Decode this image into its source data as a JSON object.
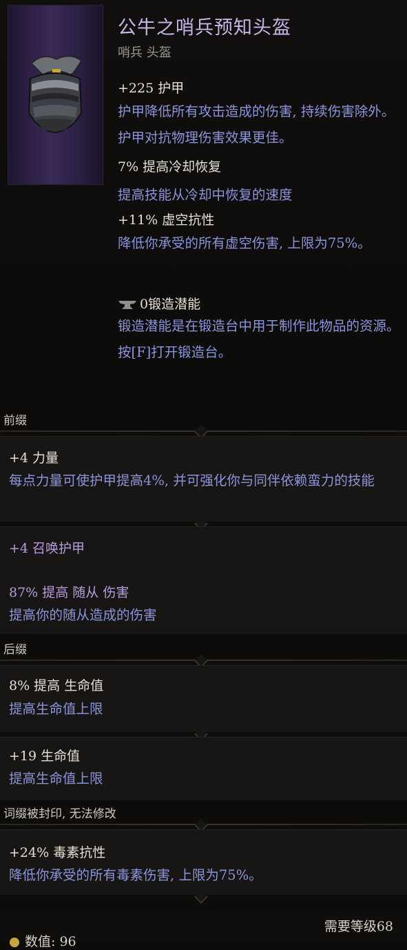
{
  "item": {
    "name": "公牛之哨兵预知头盔",
    "type": "哨兵 头盔",
    "armor_stat": "+225 护甲",
    "armor_desc": "护甲降低所有攻击造成的伤害, 持续伤害除外。护甲对抗物理伤害效果更佳。",
    "cooldown_stat": "7% 提高冷却恢复",
    "cooldown_desc": "提高技能从冷却中恢复的速度",
    "void_stat": "+11% 虚空抗性",
    "void_desc": "降低你承受的所有虚空伤害, 上限为75%。",
    "forge_stat": "0锻造潜能",
    "forge_desc": "锻造潜能是在锻造台中用于制作此物品的资源。按[F]打开锻造台。"
  },
  "prefix": {
    "header": "前缀",
    "affix1_stat": "+4 力量",
    "affix1_desc": "每点力量可使护甲提高4%, 并可强化你与同伴依赖蛮力的技能",
    "affix2_stat": "+4 召唤护甲",
    "affix2_stat2": "87% 提高 随从 伤害",
    "affix2_desc": "提高你的随从造成的伤害"
  },
  "suffix": {
    "header": "后缀",
    "affix1_stat": "8% 提高 生命值",
    "affix1_desc": "提高生命值上限",
    "affix2_stat": "+19 生命值",
    "affix2_desc": "提高生命值上限"
  },
  "sealed": {
    "header": "词缀被封印, 无法修改",
    "affix_stat": "+24% 毒素抗性",
    "affix_desc": "降低你承受的所有毒素伤害, 上限为75%。"
  },
  "footer": {
    "required_level": "需要等级68",
    "value": "数值: 96"
  },
  "icons": {
    "helmet": "helmet-icon",
    "anvil": "anvil-icon",
    "coin": "coin-icon"
  },
  "colors": {
    "title": "#c9b4e8",
    "description": "#8c94dc",
    "stat": "#e6e0d4",
    "minion": "#b89ce0"
  }
}
